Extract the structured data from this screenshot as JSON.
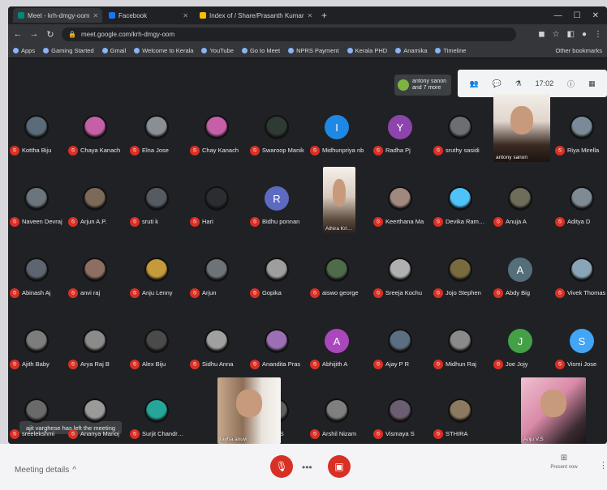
{
  "browser": {
    "tabs": [
      {
        "label": "Meet - krh-dmgy-oom",
        "active": true,
        "fav": "#00897b"
      },
      {
        "label": "Facebook",
        "active": false,
        "fav": "#1877f2"
      },
      {
        "label": "Index of / Share/Prasanth Kumar",
        "active": false,
        "fav": "#fbbc04"
      }
    ],
    "url": "meet.google.com/krh-dmgy-oom",
    "bookmarks": [
      "Apps",
      "Gaming Started",
      "Gmail",
      "Welcome to Kerala",
      "YouTube",
      "Go to Meet",
      "NPRS Payment",
      "Kerala PHD",
      "Anamika",
      "Timeline"
    ],
    "other_bookmarks": "Other bookmarks"
  },
  "meet": {
    "joined_chip": "antony sanon and 7 more",
    "panel_time": "17:02",
    "toast": "ajit varghese has left the meeting",
    "participants": [
      {
        "name": "Kottha Biju",
        "initial": "",
        "color": "#5b6b7a"
      },
      {
        "name": "Chaya Kanach",
        "initial": "",
        "color": "#c55fa8"
      },
      {
        "name": "Elna Jose",
        "initial": "",
        "color": "#8a8f95"
      },
      {
        "name": "Chay Kanach",
        "initial": "",
        "color": "#c55fa8"
      },
      {
        "name": "Swaroop Manik",
        "initial": "",
        "color": "#2e3b33"
      },
      {
        "name": "Midhunpriya nb",
        "initial": "I",
        "color": "#1e88e5"
      },
      {
        "name": "Radha Pj",
        "initial": "Y",
        "color": "#8e44ad"
      },
      {
        "name": "sruthy sasidi",
        "initial": "",
        "color": "#6b6f74"
      },
      {
        "name": "Riya Mirella",
        "initial": "",
        "color": "#7a8a99"
      },
      {
        "name": "Naveen Devraj",
        "initial": "",
        "color": "#6c757d"
      },
      {
        "name": "Arjun A.P.",
        "initial": "",
        "color": "#7b6a58"
      },
      {
        "name": "sruti k",
        "initial": "",
        "color": "#555b60"
      },
      {
        "name": "Hari",
        "initial": "",
        "color": "#2b2d30"
      },
      {
        "name": "Bidhu ponnan",
        "initial": "R",
        "color": "#5c6bc0"
      },
      {
        "name": "Keerthana Ma",
        "initial": "",
        "color": "#a1887f"
      },
      {
        "name": "Devika Ramesh",
        "initial": "",
        "color": "#4fc3f7"
      },
      {
        "name": "Anuja A",
        "initial": "",
        "color": "#6d6d5a"
      },
      {
        "name": "Aditya D",
        "initial": "",
        "color": "#7e8a94"
      },
      {
        "name": "Abinash Aj",
        "initial": "",
        "color": "#5d6670"
      },
      {
        "name": "anvi raj",
        "initial": "",
        "color": "#8d6e63"
      },
      {
        "name": "Anju Lenny",
        "initial": "",
        "color": "#c49a3a"
      },
      {
        "name": "Arjun",
        "initial": "",
        "color": "#6e7378"
      },
      {
        "name": "Gopika",
        "initial": "",
        "color": "#9e9e9e"
      },
      {
        "name": "aiswo george",
        "initial": "",
        "color": "#4e6b4a"
      },
      {
        "name": "Sreeja Kochu",
        "initial": "",
        "color": "#b0b0b0"
      },
      {
        "name": "Jojo Stephen",
        "initial": "",
        "color": "#7a6b3e"
      },
      {
        "name": "Abdy Big",
        "initial": "A",
        "color": "#546e7a"
      },
      {
        "name": "Vivek Thomas",
        "initial": "",
        "color": "#8aa4b8"
      },
      {
        "name": "Ajith Baby",
        "initial": "",
        "color": "#7d7d7d"
      },
      {
        "name": "Arya Raj B",
        "initial": "",
        "color": "#8b8b8b"
      },
      {
        "name": "Alex Biju",
        "initial": "",
        "color": "#4a4a4a"
      },
      {
        "name": "Sidhu Anna",
        "initial": "",
        "color": "#a0a0a0"
      },
      {
        "name": "Anandita Pras",
        "initial": "",
        "color": "#9c6fb5"
      },
      {
        "name": "Abhijith A",
        "initial": "A",
        "color": "#ab47bc"
      },
      {
        "name": "Ajay P R",
        "initial": "",
        "color": "#5c6f82"
      },
      {
        "name": "Midhun Raj",
        "initial": "",
        "color": "#8a8a8a"
      },
      {
        "name": "Joe Jojy",
        "initial": "J",
        "color": "#43a047"
      },
      {
        "name": "Vismi Jose",
        "initial": "S",
        "color": "#42a5f5"
      },
      {
        "name": "sreelekshmi",
        "initial": "",
        "color": "#6a6a6a"
      },
      {
        "name": "Ananya Manoj",
        "initial": "",
        "color": "#9a9a9a"
      },
      {
        "name": "Surjit Chandran",
        "initial": "",
        "color": "#26a69a"
      },
      {
        "name": "Rahul S",
        "initial": "",
        "color": "#5f5f5f"
      },
      {
        "name": "Arshil Nizam",
        "initial": "",
        "color": "#7f7f7f"
      },
      {
        "name": "Vismaya S",
        "initial": "",
        "color": "#6b5e73"
      },
      {
        "name": "STHIRA",
        "initial": "",
        "color": "#8c7a60"
      }
    ],
    "videos": [
      {
        "name": "antony sanon"
      },
      {
        "name": "Athira Krishna"
      },
      {
        "name": "rayha anuvi"
      },
      {
        "name": "Anju V.S"
      }
    ]
  },
  "bottom": {
    "meeting_details": "Meeting details",
    "present_label": "Present now"
  }
}
